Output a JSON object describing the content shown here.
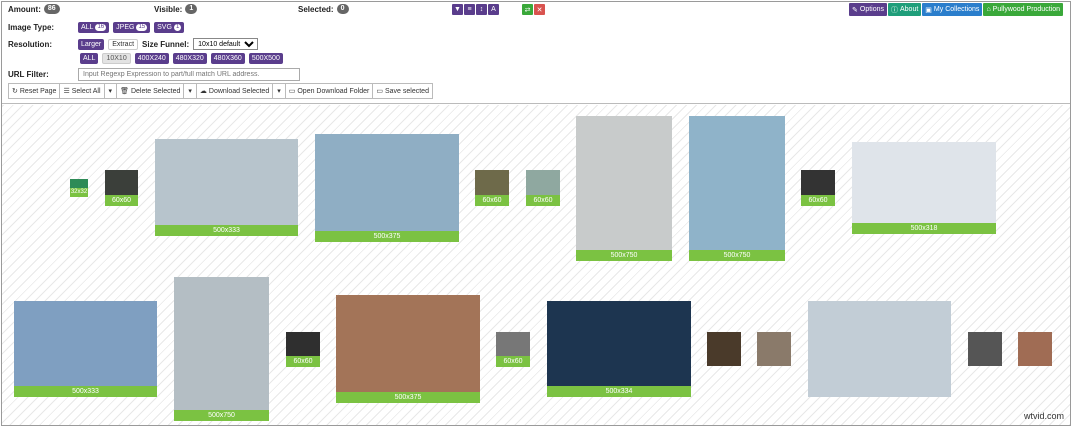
{
  "top": {
    "amount_label": "Amount:",
    "amount_value": "86",
    "visible_label": "Visible:",
    "visible_value": "1",
    "selected_label": "Selected:",
    "selected_value": "0",
    "nav": {
      "options": "Options",
      "about": "About",
      "collections": "My Collections",
      "production": "Pullywood Production"
    }
  },
  "controls": {
    "image_type_label": "Image Type:",
    "types": [
      {
        "label": "ALL",
        "count": "16"
      },
      {
        "label": "JPEG",
        "count": "15"
      },
      {
        "label": "SVG",
        "count": "1"
      }
    ],
    "resolution_label": "Resolution:",
    "larger_label": "Larger",
    "extract_label": "Extract",
    "size_funnel_label": "Size Funnel:",
    "size_funnel_value": "10x10 default",
    "sizes": [
      "ALL",
      "10X10",
      "400X240",
      "480X320",
      "480X360",
      "500X500"
    ],
    "url_filter_label": "URL Filter:",
    "url_placeholder": "Input Regexp Expression to part/full match URL address.",
    "actions": {
      "reset": "Reset Page",
      "select_all": "Select All",
      "delete": "Delete Selected",
      "download": "Download Selected",
      "open_folder": "Open Download Folder",
      "save": "Save selected"
    }
  },
  "images": [
    {
      "caption": "32x32",
      "color": "#2e8b57"
    },
    {
      "caption": "60x60",
      "color": "#3b3f3a"
    },
    {
      "caption": "500x333",
      "color": "#b7c4cc"
    },
    {
      "caption": "500x375",
      "color": "#8faec4"
    },
    {
      "caption": "60x60",
      "color": "#6e6a4a"
    },
    {
      "caption": "60x60",
      "color": "#8fa8a0"
    },
    {
      "caption": "500x750",
      "color": "#c8cbcb"
    },
    {
      "caption": "500x750",
      "color": "#8fb3c9"
    },
    {
      "caption": "60x60",
      "color": "#333333"
    },
    {
      "caption": "500x318",
      "color": "#dfe4ea"
    },
    {
      "caption": "500x333",
      "color": "#7f9fc1"
    },
    {
      "caption": "500x750",
      "color": "#b4bec4"
    },
    {
      "caption": "60x60",
      "color": "#2f2f2f"
    },
    {
      "caption": "500x375",
      "color": "#a37458"
    },
    {
      "caption": "60x60",
      "color": "#777777"
    },
    {
      "caption": "500x334",
      "color": "#1d3550"
    },
    {
      "caption": "",
      "color": "#4a3a2a"
    },
    {
      "caption": "",
      "color": "#8a7a6a"
    },
    {
      "caption": "",
      "color": "#c2cdd6"
    },
    {
      "caption": "",
      "color": "#555555"
    },
    {
      "caption": "",
      "color": "#a06c54"
    }
  ],
  "watermark": "wtvid.com"
}
